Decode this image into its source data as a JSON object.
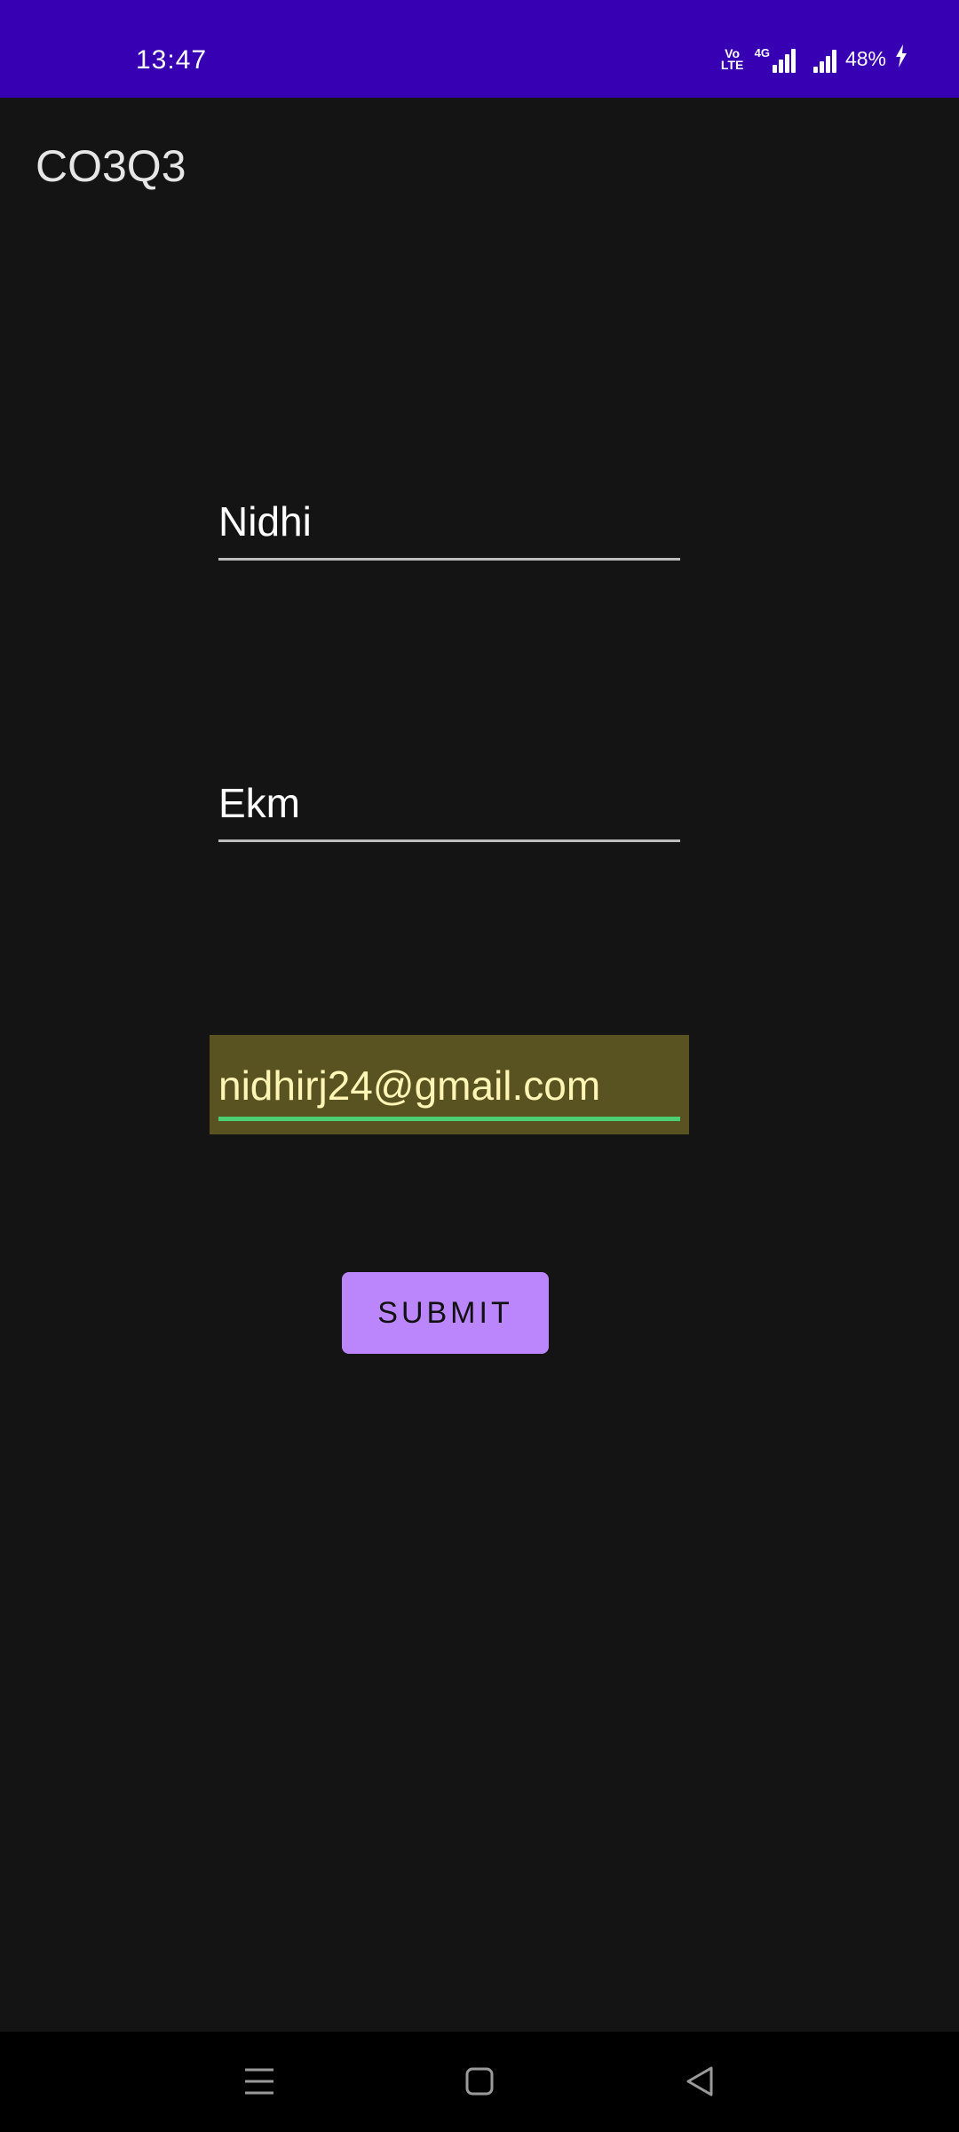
{
  "status_bar": {
    "time": "13:47",
    "volte_label_top": "Vo",
    "volte_label_bottom": "LTE",
    "network_tag": "4G",
    "battery_percent": "48%",
    "icons": [
      "volte-icon",
      "signal-4g-icon",
      "signal-icon",
      "charging-icon"
    ],
    "background_color": "#3700b3"
  },
  "app_bar": {
    "title": "CO3Q3"
  },
  "form": {
    "name_value": "Nidhi",
    "place_value": "Ekm",
    "email_value": "nidhirj24@gmail.com",
    "email_highlight_color": "#595221",
    "email_underline_color": "#4ccf73"
  },
  "submit": {
    "label": "SUBMIT",
    "color": "#bb86fc"
  },
  "nav_bar": {
    "icons": [
      "menu-icon",
      "home-icon",
      "back-icon"
    ]
  }
}
